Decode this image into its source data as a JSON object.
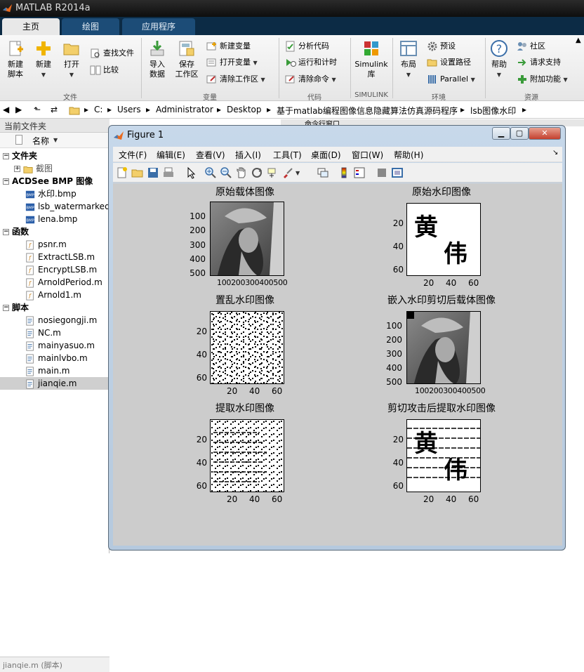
{
  "app": {
    "title": "MATLAB R2014a"
  },
  "tabs": [
    {
      "label": "主页"
    },
    {
      "label": "绘图"
    },
    {
      "label": "应用程序"
    }
  ],
  "ribbon": {
    "file": {
      "new_script": "新建\n脚本",
      "new": "新建",
      "open": "打开",
      "find_files": "查找文件",
      "compare": "比较",
      "label": "文件"
    },
    "variable": {
      "import": "导入\n数据",
      "save": "保存\n工作区",
      "new_var": "新建变量",
      "open_var": "打开变量",
      "clear_ws": "清除工作区",
      "label": "变量"
    },
    "code": {
      "analyze": "分析代码",
      "run_time": "运行和计时",
      "clear_cmd": "清除命令",
      "label": "代码"
    },
    "simulink": {
      "lib": "Simulink\n库",
      "label": "SIMULINK"
    },
    "env": {
      "layout": "布局",
      "prefs": "预设",
      "path": "设置路径",
      "parallel": "Parallel",
      "label": "环境"
    },
    "resources": {
      "help": "帮助",
      "community": "社区",
      "support": "请求支持",
      "addons": "附加功能",
      "label": "资源"
    }
  },
  "address": {
    "crumbs": [
      "C:",
      "Users",
      "Administrator",
      "Desktop",
      "基于matlab编程图像信息隐藏算法仿真源码程序",
      "lsb图像水印"
    ]
  },
  "left_panel": {
    "title": "当前文件夹",
    "col_name": "名称",
    "groups": [
      {
        "label": "文件夹",
        "items": [
          "截图"
        ]
      },
      {
        "label": "ACDSee BMP 图像",
        "items": [
          "水印.bmp",
          "lsb_watermarked",
          "lena.bmp"
        ]
      },
      {
        "label": "函数",
        "items": [
          "psnr.m",
          "ExtractLSB.m",
          "EncryptLSB.m",
          "ArnoldPeriod.m",
          "Arnold1.m"
        ]
      },
      {
        "label": "脚本",
        "items": [
          "nosiegongji.m",
          "NC.m",
          "mainyasuo.m",
          "mainlvbo.m",
          "main.m",
          "jianqie.m"
        ]
      }
    ],
    "status_name": "jianqie.m",
    "status_type": "(脚本)",
    "hidden_header": "命令行窗口"
  },
  "figure": {
    "title": "Figure 1",
    "menu": [
      "文件(F)",
      "编辑(E)",
      "查看(V)",
      "插入(I)",
      "工具(T)",
      "桌面(D)",
      "窗口(W)",
      "帮助(H)"
    ],
    "plots": [
      {
        "title": "原始载体图像",
        "yticks": [
          "100",
          "200",
          "300",
          "400",
          "500"
        ],
        "xticks": [
          "100200300400500"
        ]
      },
      {
        "title": "原始水印图像",
        "yticks": [
          "20",
          "40",
          "60"
        ],
        "xticks": [
          "20",
          "40",
          "60"
        ]
      },
      {
        "title": "置乱水印图像",
        "yticks": [
          "20",
          "40",
          "60"
        ],
        "xticks": [
          "20",
          "40",
          "60"
        ]
      },
      {
        "title": "嵌入水印剪切后载体图像",
        "yticks": [
          "100",
          "200",
          "300",
          "400",
          "500"
        ],
        "xticks": [
          "100200300400500"
        ]
      },
      {
        "title": "提取水印图像",
        "yticks": [
          "20",
          "40",
          "60"
        ],
        "xticks": [
          "20",
          "40",
          "60"
        ]
      },
      {
        "title": "剪切攻击后提取水印图像",
        "yticks": [
          "20",
          "40",
          "60"
        ],
        "xticks": [
          "20",
          "40",
          "60"
        ]
      }
    ],
    "watermark_chars": [
      "黄",
      "伟"
    ]
  }
}
